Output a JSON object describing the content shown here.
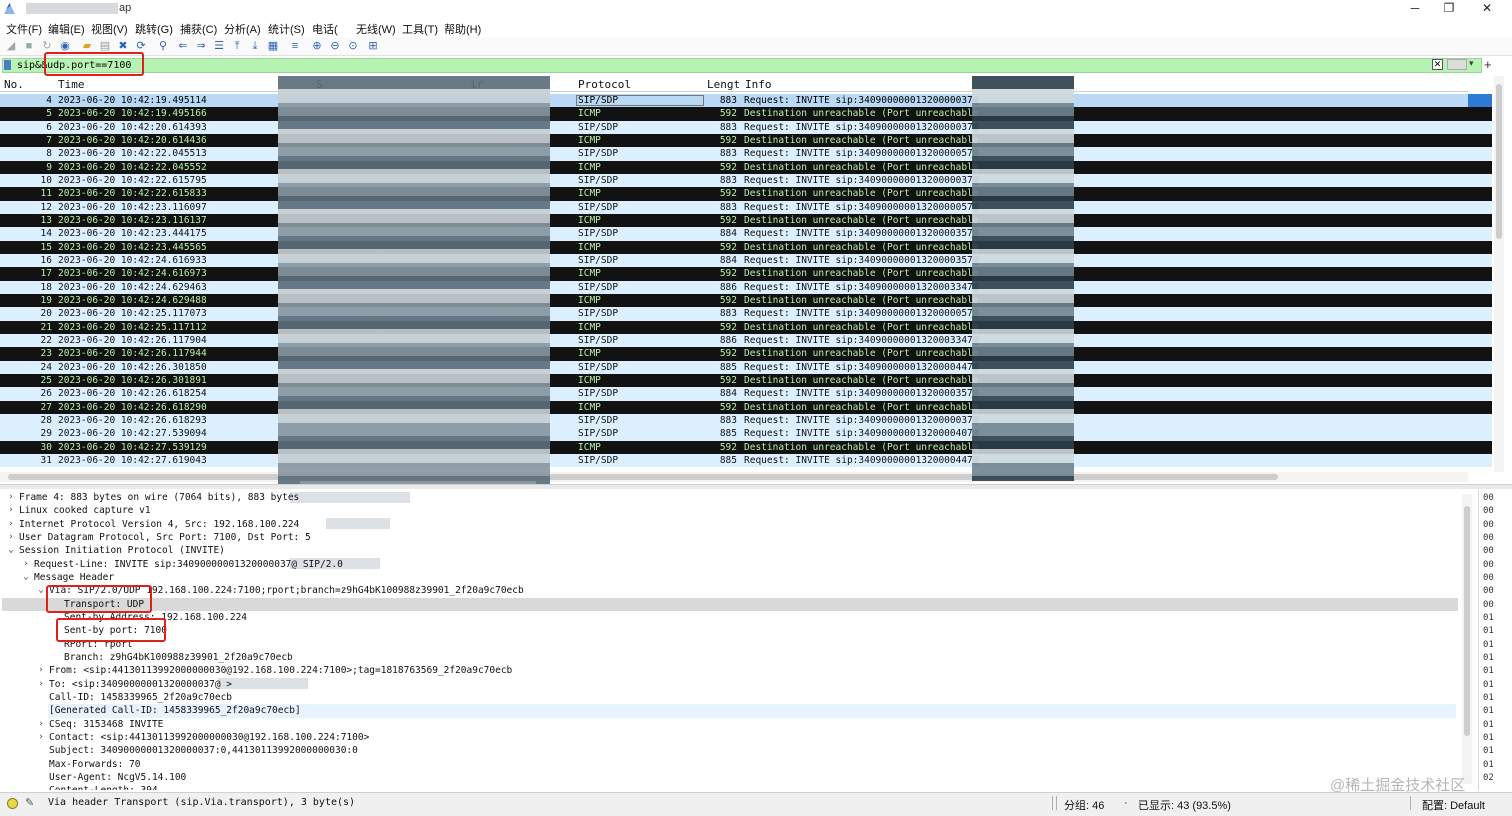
{
  "window": {
    "title_prefix": "",
    "title_suffix": "ap",
    "minimize": "─",
    "maximize": "❐",
    "close": "✕"
  },
  "menu": [
    "文件(F)",
    "编辑(E)",
    "视图(V)",
    "跳转(G)",
    "捕获(C)",
    "分析(A)",
    "统计(S)",
    "电话(",
    "无线(W)",
    "工具(T)",
    "帮助(H)"
  ],
  "filter": {
    "value": "sip&&udp.port==7100",
    "clear": "✕",
    "dropdown": "▾",
    "add": "+"
  },
  "packet_list": {
    "headers": {
      "no": "No.",
      "time": "Time",
      "source": "S",
      "destination": "ir",
      "protocol": "Protocol",
      "length": "Lengt",
      "info": "Info"
    },
    "rows": [
      {
        "no": "4",
        "time": "2023-06-20 10:42:19.495114",
        "proto": "SIP/SDP",
        "len": "883",
        "info": "Request: INVITE sip:34090000001320000037@",
        "kind": "selected"
      },
      {
        "no": "5",
        "time": "2023-06-20 10:42:19.495166",
        "proto": "ICMP",
        "len": "592",
        "info": "Destination unreachable (Port unreachable",
        "kind": "icmp"
      },
      {
        "no": "6",
        "time": "2023-06-20 10:42:20.614393",
        "proto": "SIP/SDP",
        "len": "883",
        "info": "Request: INVITE sip:34090000001320000037@",
        "kind": "sip"
      },
      {
        "no": "7",
        "time": "2023-06-20 10:42:20.614436",
        "proto": "ICMP",
        "len": "592",
        "info": "Destination unreachable (Port unreachable",
        "kind": "icmp"
      },
      {
        "no": "8",
        "time": "2023-06-20 10:42:22.045513",
        "proto": "SIP/SDP",
        "len": "883",
        "info": "Request: INVITE sip:34090000001320000057@",
        "kind": "sip"
      },
      {
        "no": "9",
        "time": "2023-06-20 10:42:22.045552",
        "proto": "ICMP",
        "len": "592",
        "info": "Destination unreachable (Port unreachable",
        "kind": "icmp"
      },
      {
        "no": "10",
        "time": "2023-06-20 10:42:22.615795",
        "proto": "SIP/SDP",
        "len": "883",
        "info": "Request: INVITE sip:34090000001320000037@",
        "kind": "sip"
      },
      {
        "no": "11",
        "time": "2023-06-20 10:42:22.615833",
        "proto": "ICMP",
        "len": "592",
        "info": "Destination unreachable (Port unreachable",
        "kind": "icmp"
      },
      {
        "no": "12",
        "time": "2023-06-20 10:42:23.116097",
        "proto": "SIP/SDP",
        "len": "883",
        "info": "Request: INVITE sip:34090000001320000057@",
        "kind": "sip"
      },
      {
        "no": "13",
        "time": "2023-06-20 10:42:23.116137",
        "proto": "ICMP",
        "len": "592",
        "info": "Destination unreachable (Port unreachable",
        "kind": "icmp"
      },
      {
        "no": "14",
        "time": "2023-06-20 10:42:23.444175",
        "proto": "SIP/SDP",
        "len": "884",
        "info": "Request: INVITE sip:34090000001320000357@",
        "kind": "sip"
      },
      {
        "no": "15",
        "time": "2023-06-20 10:42:23.445565",
        "proto": "ICMP",
        "len": "592",
        "info": "Destination unreachable (Port unreachable",
        "kind": "icmp"
      },
      {
        "no": "16",
        "time": "2023-06-20 10:42:24.616933",
        "proto": "SIP/SDP",
        "len": "884",
        "info": "Request: INVITE sip:34090000001320000357@",
        "kind": "sip"
      },
      {
        "no": "17",
        "time": "2023-06-20 10:42:24.616973",
        "proto": "ICMP",
        "len": "592",
        "info": "Destination unreachable (Port unreachable",
        "kind": "icmp"
      },
      {
        "no": "18",
        "time": "2023-06-20 10:42:24.629463",
        "proto": "SIP/SDP",
        "len": "886",
        "info": "Request: INVITE sip:34090000001320003347@",
        "kind": "sip"
      },
      {
        "no": "19",
        "time": "2023-06-20 10:42:24.629488",
        "proto": "ICMP",
        "len": "592",
        "info": "Destination unreachable (Port unreachable",
        "kind": "icmp"
      },
      {
        "no": "20",
        "time": "2023-06-20 10:42:25.117073",
        "proto": "SIP/SDP",
        "len": "883",
        "info": "Request: INVITE sip:34090000001320000057@",
        "kind": "sip"
      },
      {
        "no": "21",
        "time": "2023-06-20 10:42:25.117112",
        "proto": "ICMP",
        "len": "592",
        "info": "Destination unreachable (Port unreachable",
        "kind": "icmp"
      },
      {
        "no": "22",
        "time": "2023-06-20 10:42:26.117904",
        "proto": "SIP/SDP",
        "len": "886",
        "info": "Request: INVITE sip:34090000001320003347@",
        "kind": "sip"
      },
      {
        "no": "23",
        "time": "2023-06-20 10:42:26.117944",
        "proto": "ICMP",
        "len": "592",
        "info": "Destination unreachable (Port unreachable",
        "kind": "icmp"
      },
      {
        "no": "24",
        "time": "2023-06-20 10:42:26.301850",
        "proto": "SIP/SDP",
        "len": "885",
        "info": "Request: INVITE sip:34090000001320000447@",
        "kind": "sip"
      },
      {
        "no": "25",
        "time": "2023-06-20 10:42:26.301891",
        "proto": "ICMP",
        "len": "592",
        "info": "Destination unreachable (Port unreachable",
        "kind": "icmp"
      },
      {
        "no": "26",
        "time": "2023-06-20 10:42:26.618254",
        "proto": "SIP/SDP",
        "len": "884",
        "info": "Request: INVITE sip:34090000001320000357@",
        "kind": "sip"
      },
      {
        "no": "27",
        "time": "2023-06-20 10:42:26.618290",
        "proto": "ICMP",
        "len": "592",
        "info": "Destination unreachable (Port unreachable",
        "kind": "icmp"
      },
      {
        "no": "28",
        "time": "2023-06-20 10:42:26.618293",
        "proto": "SIP/SDP",
        "len": "883",
        "info": "Request: INVITE sip:34090000001320000037@",
        "kind": "sip"
      },
      {
        "no": "29",
        "time": "2023-06-20 10:42:27.539094",
        "proto": "SIP/SDP",
        "len": "885",
        "info": "Request: INVITE sip:34090000001320000407@",
        "kind": "sip"
      },
      {
        "no": "30",
        "time": "2023-06-20 10:42:27.539129",
        "proto": "ICMP",
        "len": "592",
        "info": "Destination unreachable (Port unreachable",
        "kind": "icmp"
      },
      {
        "no": "31",
        "time": "2023-06-20 10:42:27.619043",
        "proto": "SIP/SDP",
        "len": "885",
        "info": "Request: INVITE sip:34090000001320000447@",
        "kind": "sip"
      }
    ]
  },
  "details": [
    {
      "indent": 0,
      "arrow": "›",
      "text": "Frame 4: 883 bytes on wire (7064 bits), 883 bytes"
    },
    {
      "indent": 0,
      "arrow": "›",
      "text": "Linux cooked capture v1"
    },
    {
      "indent": 0,
      "arrow": "›",
      "text": "Internet Protocol Version 4, Src: 192.168.100.224"
    },
    {
      "indent": 0,
      "arrow": "›",
      "text": "User Datagram Protocol, Src Port: 7100, Dst Port: 5"
    },
    {
      "indent": 0,
      "arrow": "⌄",
      "text": "Session Initiation Protocol (INVITE)"
    },
    {
      "indent": 1,
      "arrow": "›",
      "text": "Request-Line: INVITE sip:34090000001320000037@                    SIP/2.0"
    },
    {
      "indent": 1,
      "arrow": "⌄",
      "text": "Message Header"
    },
    {
      "indent": 2,
      "arrow": "⌄",
      "text": "Via: SIP/2.0/UDP 192.168.100.224:7100;rport;branch=z9hG4bK100988z39901_2f20a9c70ecb"
    },
    {
      "indent": 3,
      "arrow": "",
      "text": "Transport: UDP"
    },
    {
      "indent": 3,
      "arrow": "",
      "text": "Sent-by Address: 192.168.100.224"
    },
    {
      "indent": 3,
      "arrow": "",
      "text": "Sent-by port: 7100"
    },
    {
      "indent": 3,
      "arrow": "",
      "text": "RPort: rport"
    },
    {
      "indent": 3,
      "arrow": "",
      "text": "Branch: z9hG4bK100988z39901_2f20a9c70ecb"
    },
    {
      "indent": 2,
      "arrow": "›",
      "text": "From: <sip:44130113992000000030@192.168.100.224:7100>;tag=1818763569_2f20a9c70ecb"
    },
    {
      "indent": 2,
      "arrow": "›",
      "text": "To: <sip:34090000001320000037@                >"
    },
    {
      "indent": 2,
      "arrow": "",
      "text": "Call-ID: 1458339965_2f20a9c70ecb"
    },
    {
      "indent": 2,
      "arrow": "",
      "text": "[Generated Call-ID: 1458339965_2f20a9c70ecb]"
    },
    {
      "indent": 2,
      "arrow": "›",
      "text": "CSeq: 3153468 INVITE"
    },
    {
      "indent": 2,
      "arrow": "›",
      "text": "Contact: <sip:44130113992000000030@192.168.100.224:7100>"
    },
    {
      "indent": 2,
      "arrow": "",
      "text": "Subject: 34090000001320000037:0,44130113992000000030:0"
    },
    {
      "indent": 2,
      "arrow": "",
      "text": "Max-Forwards: 70"
    },
    {
      "indent": 2,
      "arrow": "",
      "text": "User-Agent: NcgV5.14.100"
    },
    {
      "indent": 2,
      "arrow": "",
      "text": "Content-Length: 394"
    }
  ],
  "hex": [
    "00",
    "00",
    "00",
    "00",
    "00",
    "00",
    "00",
    "00",
    "00",
    "01",
    "01",
    "01",
    "01",
    "01",
    "01",
    "01",
    "01",
    "01",
    "01",
    "01",
    "01",
    "02"
  ],
  "status": {
    "message": "Via header Transport (sip.Via.transport), 3 byte(s)",
    "packets": "分组: 46",
    "separator": "·",
    "displayed": "已显示: 43 (93.5%)",
    "profile": "配置: Default",
    "edit_icon": "✎"
  },
  "watermark": "@稀土掘金技术社区",
  "colors": {
    "sip_row": "#dcefff",
    "icmp_row": "#121212",
    "icmp_text": "#b9f0ac",
    "selected_row": "#b9d9f5",
    "filter_valid": "#b7f4b3",
    "annotation": "#e0201b"
  }
}
